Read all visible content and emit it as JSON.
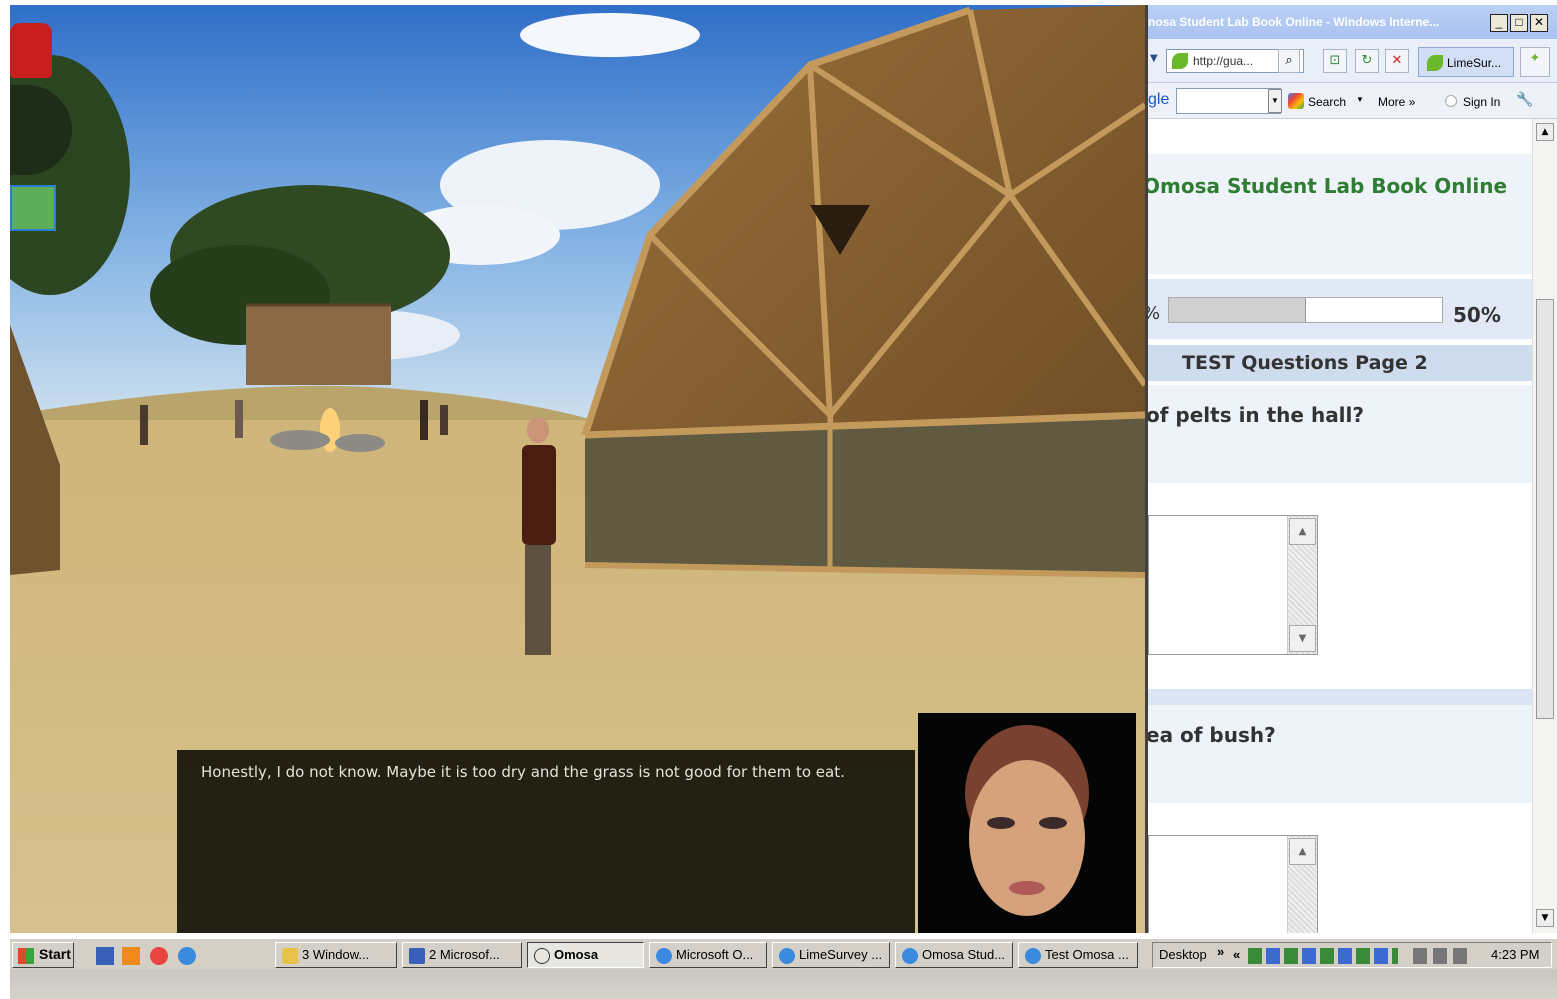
{
  "game": {
    "dialog_text": "Honestly, I do not know.  Maybe it is too dry and the grass is not good for them to eat."
  },
  "browser": {
    "title": "nosa Student Lab Book Online - Windows Interne...",
    "address": "http://gua...",
    "tab_label": "LimeSur...",
    "google_prefix": "gle",
    "search_label": "Search",
    "more_label": "More »",
    "signin_label": "Sign In",
    "page": {
      "heading": "Omosa Student Lab Book Online",
      "progress_left": "%",
      "progress_right": "50%",
      "progress_value": 0.5,
      "section_title": "TEST Questions Page 2",
      "question1": "of pelts in the hall?",
      "question2": "ea of bush?"
    }
  },
  "taskbar": {
    "start_label": "start",
    "items": [
      {
        "label": "3 Window..."
      },
      {
        "label": "2 Microsof..."
      },
      {
        "label": "Omosa"
      },
      {
        "label": "Microsoft O..."
      },
      {
        "label": "LimeSurvey ..."
      },
      {
        "label": "Omosa Stud..."
      },
      {
        "label": "Test Omosa ..."
      }
    ],
    "desktop_label": "Desktop",
    "clock": "4:23 PM"
  },
  "colors": {
    "heading_green": "#2e7d32",
    "band_blue": "#e8eef8",
    "section_blue": "#cfdcee"
  }
}
